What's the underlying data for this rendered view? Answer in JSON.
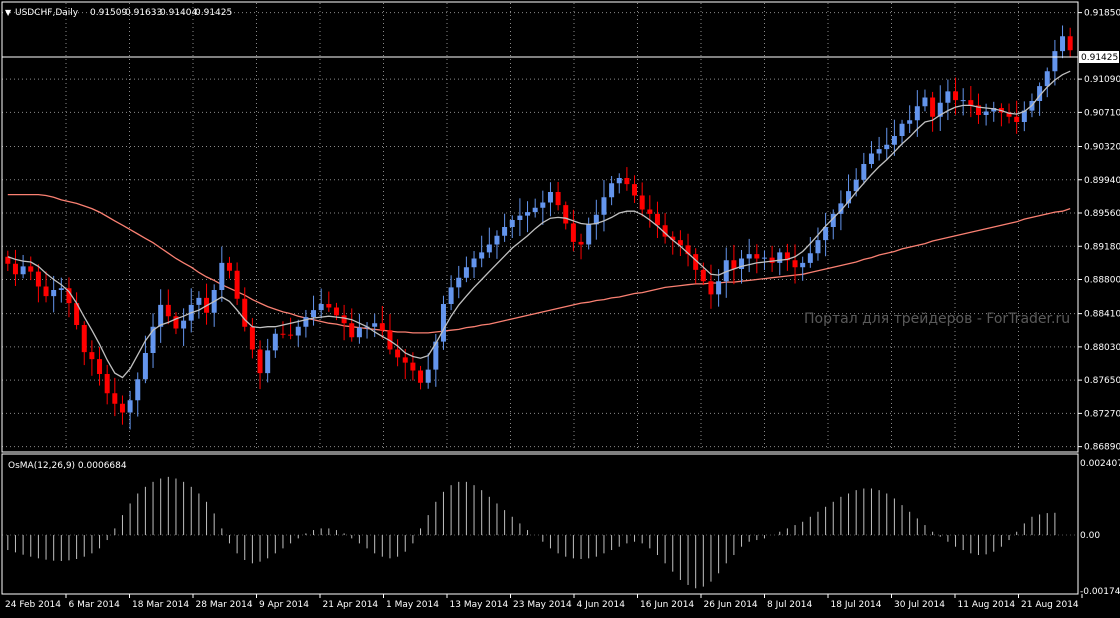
{
  "window": {
    "symbol_label": "USDCHF,Daily",
    "ohlc": [
      "0.91509",
      "0.91633",
      "0.91404",
      "0.91425"
    ],
    "watermark": "Портал для трейдеров - ForTrader.ru"
  },
  "price_panel": {
    "current_price": "0.91425",
    "y_axis_ticks": [
      "0.91850",
      "0.91090",
      "0.90710",
      "0.90320",
      "0.89940",
      "0.89560",
      "0.89180",
      "0.88800",
      "0.88410",
      "0.88030",
      "0.87650",
      "0.87270",
      "0.86890"
    ],
    "ylim": [
      0.8684,
      0.9196
    ]
  },
  "osma_panel": {
    "label": "OsMA(12,26,9) 0.0006684",
    "y_axis_ticks": [
      "0.002407",
      "0.00",
      "-0.001742"
    ],
    "ylim": [
      -0.001742,
      0.002407
    ]
  },
  "x_axis": {
    "date_labels": [
      "24 Feb 2014",
      "6 Mar 2014",
      "18 Mar 2014",
      "28 Mar 2014",
      "9 Apr 2014",
      "21 Apr 2014",
      "1 May 2014",
      "13 May 2014",
      "23 May 2014",
      "4 Jun 2014",
      "16 Jun 2014",
      "26 Jun 2014",
      "8 Jul 2014",
      "18 Jul 2014",
      "30 Jul 2014",
      "11 Aug 2014",
      "21 Aug 2014"
    ]
  },
  "colors": {
    "background": "#000000",
    "grid": "#8a8a8a",
    "bull_candle": "#6495ED",
    "bear_candle": "#FF0000",
    "fast_ma": "#C0C0C0",
    "slow_ma": "#FA8072",
    "osma_bars": "#C0C0C0",
    "axis_text": "#FFFFFF"
  },
  "chart_data": {
    "type": "candlestick",
    "symbol": "USDCHF",
    "timeframe": "Daily",
    "close": [
      0.8898,
      0.8886,
      0.8895,
      0.8889,
      0.8872,
      0.8861,
      0.8868,
      0.887,
      0.8853,
      0.8828,
      0.8797,
      0.8789,
      0.8772,
      0.875,
      0.8738,
      0.8728,
      0.8742,
      0.8766,
      0.8796,
      0.8826,
      0.8851,
      0.8838,
      0.8824,
      0.8833,
      0.8851,
      0.8859,
      0.8842,
      0.8868,
      0.8899,
      0.889,
      0.8858,
      0.8826,
      0.88,
      0.8773,
      0.8799,
      0.8818,
      0.8817,
      0.8816,
      0.8826,
      0.8837,
      0.8845,
      0.8852,
      0.8848,
      0.8839,
      0.883,
      0.8814,
      0.8825,
      0.8826,
      0.883,
      0.8822,
      0.88,
      0.8791,
      0.8785,
      0.8776,
      0.8762,
      0.8777,
      0.8809,
      0.8852,
      0.8871,
      0.8882,
      0.8894,
      0.8904,
      0.8911,
      0.892,
      0.893,
      0.894,
      0.8948,
      0.8953,
      0.8957,
      0.8962,
      0.8968,
      0.898,
      0.8965,
      0.8944,
      0.8923,
      0.892,
      0.8943,
      0.8954,
      0.8974,
      0.899,
      0.8996,
      0.8989,
      0.8976,
      0.896,
      0.8955,
      0.8942,
      0.8929,
      0.8925,
      0.8919,
      0.8909,
      0.8891,
      0.8878,
      0.8863,
      0.8878,
      0.8902,
      0.8892,
      0.8904,
      0.8909,
      0.8904,
      0.8905,
      0.8899,
      0.8911,
      0.8902,
      0.8894,
      0.8899,
      0.891,
      0.8925,
      0.894,
      0.8955,
      0.8967,
      0.8981,
      0.8994,
      0.9012,
      0.9024,
      0.9029,
      0.9034,
      0.9044,
      0.9058,
      0.9062,
      0.9078,
      0.9088,
      0.9066,
      0.9082,
      0.9095,
      0.9085,
      0.9085,
      0.9079,
      0.9068,
      0.9072,
      0.9076,
      0.9071,
      0.9066,
      0.906,
      0.9073,
      0.9084,
      0.9101,
      0.9118,
      0.9141,
      0.9158,
      0.9142
    ],
    "fast_ma": [
      0.8906,
      0.8903,
      0.8901,
      0.89,
      0.8895,
      0.8887,
      0.888,
      0.8874,
      0.8866,
      0.8853,
      0.8837,
      0.8822,
      0.8806,
      0.8788,
      0.8773,
      0.8768,
      0.8778,
      0.8794,
      0.881,
      0.8822,
      0.8828,
      0.8831,
      0.8835,
      0.8838,
      0.8842,
      0.8845,
      0.885,
      0.8855,
      0.886,
      0.8855,
      0.8845,
      0.8834,
      0.8826,
      0.8825,
      0.8826,
      0.8826,
      0.8828,
      0.883,
      0.8832,
      0.8834,
      0.8836,
      0.8837,
      0.8838,
      0.8837,
      0.8836,
      0.8834,
      0.883,
      0.8826,
      0.882,
      0.8815,
      0.881,
      0.8804,
      0.8796,
      0.8792,
      0.879,
      0.8793,
      0.8807,
      0.8823,
      0.8838,
      0.8851,
      0.8861,
      0.8871,
      0.888,
      0.8889,
      0.8898,
      0.8907,
      0.8916,
      0.8923,
      0.893,
      0.8938,
      0.8945,
      0.895,
      0.8951,
      0.895,
      0.8947,
      0.8944,
      0.8943,
      0.8944,
      0.8947,
      0.8951,
      0.8956,
      0.8958,
      0.8958,
      0.8954,
      0.8948,
      0.8941,
      0.8933,
      0.8925,
      0.8918,
      0.891,
      0.8902,
      0.8894,
      0.8886,
      0.8885,
      0.8889,
      0.8892,
      0.8895,
      0.8897,
      0.8899,
      0.89,
      0.8901,
      0.8902,
      0.8903,
      0.8906,
      0.8912,
      0.8921,
      0.8931,
      0.8941,
      0.895,
      0.8959,
      0.8969,
      0.898,
      0.899,
      0.9,
      0.9009,
      0.9017,
      0.9026,
      0.9035,
      0.9043,
      0.9052,
      0.906,
      0.9062,
      0.9068,
      0.9073,
      0.9077,
      0.9079,
      0.9079,
      0.9077,
      0.9076,
      0.9075,
      0.9073,
      0.907,
      0.9069,
      0.9072,
      0.9079,
      0.909,
      0.91,
      0.9108,
      0.9114,
      0.9118
    ],
    "slow_ma": [
      0.8977,
      0.8977,
      0.8977,
      0.8977,
      0.8977,
      0.8976,
      0.8974,
      0.8971,
      0.8969,
      0.8967,
      0.8964,
      0.8961,
      0.8957,
      0.8952,
      0.8947,
      0.8942,
      0.8937,
      0.8932,
      0.8927,
      0.8922,
      0.8916,
      0.891,
      0.8904,
      0.8899,
      0.8894,
      0.8888,
      0.8883,
      0.8879,
      0.8874,
      0.887,
      0.8866,
      0.8862,
      0.8857,
      0.8853,
      0.8849,
      0.8846,
      0.8843,
      0.8841,
      0.8838,
      0.8836,
      0.8834,
      0.8832,
      0.883,
      0.8829,
      0.8827,
      0.8826,
      0.8825,
      0.8824,
      0.8823,
      0.8822,
      0.8821,
      0.882,
      0.882,
      0.8819,
      0.8819,
      0.8819,
      0.882,
      0.8821,
      0.8822,
      0.8823,
      0.8825,
      0.8826,
      0.8828,
      0.8829,
      0.8831,
      0.8833,
      0.8835,
      0.8837,
      0.8839,
      0.8841,
      0.8843,
      0.8845,
      0.8847,
      0.8849,
      0.8851,
      0.8853,
      0.8854,
      0.8856,
      0.8857,
      0.8859,
      0.886,
      0.8862,
      0.8864,
      0.8865,
      0.8867,
      0.8869,
      0.8871,
      0.8872,
      0.8873,
      0.8874,
      0.8875,
      0.8875,
      0.8876,
      0.8876,
      0.8877,
      0.8877,
      0.8878,
      0.8879,
      0.888,
      0.8881,
      0.8882,
      0.8883,
      0.8884,
      0.8885,
      0.8886,
      0.8888,
      0.889,
      0.8892,
      0.8894,
      0.8896,
      0.8898,
      0.89,
      0.8903,
      0.8905,
      0.8908,
      0.891,
      0.8912,
      0.8915,
      0.8917,
      0.8919,
      0.8921,
      0.8924,
      0.8926,
      0.8928,
      0.893,
      0.8932,
      0.8934,
      0.8936,
      0.8938,
      0.894,
      0.8942,
      0.8944,
      0.8946,
      0.8949,
      0.8951,
      0.8953,
      0.8955,
      0.8957,
      0.8958,
      0.8961
    ],
    "osma": [
      -0.00045,
      -0.00052,
      -0.00059,
      -0.00065,
      -0.0007,
      -0.00074,
      -0.00077,
      -0.00078,
      -0.00076,
      -0.00072,
      -0.00065,
      -0.00055,
      -0.0004,
      -0.00015,
      0.0002,
      0.0006,
      0.00095,
      0.00125,
      0.00145,
      0.0016,
      0.0017,
      0.00175,
      0.0017,
      0.0016,
      0.00145,
      0.00125,
      0.001,
      0.00065,
      0.0002,
      -0.00025,
      -0.00055,
      -0.00075,
      -0.00085,
      -0.0008,
      -0.0007,
      -0.00055,
      -0.0004,
      -0.00025,
      -0.0001,
      5e-05,
      0.00015,
      0.0002,
      0.0002,
      0.00015,
      5e-05,
      -0.0001,
      -0.00025,
      -0.0004,
      -0.00055,
      -0.00065,
      -0.0007,
      -0.00065,
      -0.0005,
      -0.00025,
      0.0002,
      0.0006,
      0.001,
      0.0013,
      0.0015,
      0.0016,
      0.0016,
      0.0015,
      0.00135,
      0.00115,
      0.00095,
      0.00075,
      0.00055,
      0.00035,
      0.00015,
      0.0,
      -0.0002,
      -0.0004,
      -0.00055,
      -0.00065,
      -0.0007,
      -0.00072,
      -0.0007,
      -0.00065,
      -0.00055,
      -0.00045,
      -0.00035,
      -0.00025,
      -0.0002,
      -0.00025,
      -0.0004,
      -0.0006,
      -0.00085,
      -0.0011,
      -0.00135,
      -0.0015,
      -0.0016,
      -0.00155,
      -0.0014,
      -0.00115,
      -0.00085,
      -0.0006,
      -0.00035,
      -0.0002,
      -0.00015,
      -0.0001,
      0.0,
      0.0001,
      0.0002,
      0.0003,
      0.0004,
      0.00055,
      0.0007,
      0.00085,
      0.001,
      0.00115,
      0.00125,
      0.00135,
      0.0014,
      0.0014,
      0.00135,
      0.00125,
      0.0011,
      0.0009,
      0.0007,
      0.0005,
      0.0003,
      0.0001,
      -5e-05,
      -0.0002,
      -0.00035,
      -0.00045,
      -0.00055,
      -0.0006,
      -0.00058,
      -0.0005,
      -0.00035,
      -0.00015,
      0.0001,
      0.00035,
      0.00055,
      0.00062,
      0.00066,
      0.00067
    ]
  }
}
